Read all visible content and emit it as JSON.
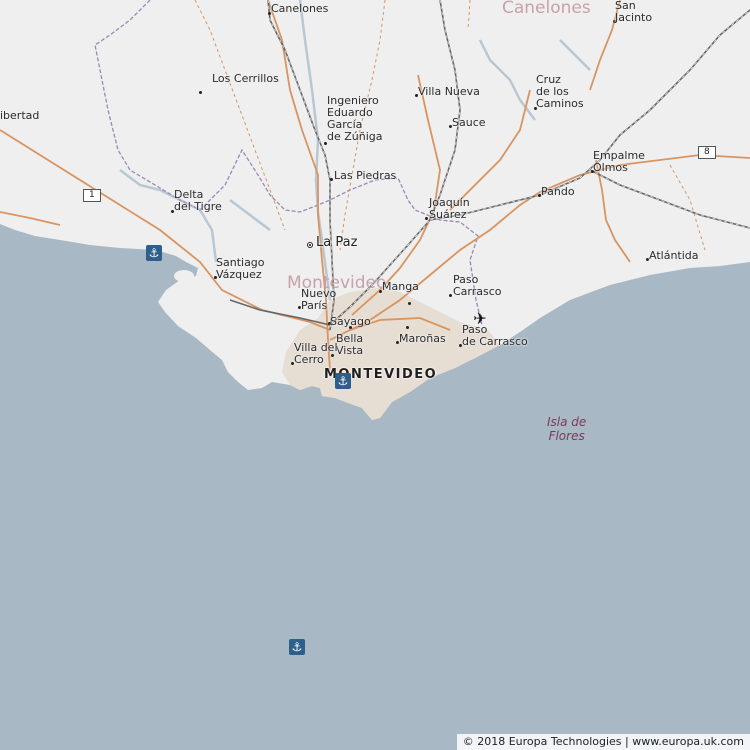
{
  "map": {
    "colors": {
      "water": "#a9b8c5",
      "land": "#efefef",
      "urban": "#e6ddd3",
      "road": "#d99460",
      "rail": "#666666",
      "border": "#9a88b8",
      "river": "#b9c7d3"
    },
    "admin_labels": {
      "canelones_dept": "Canelones",
      "montevideo_dept": "Montevideo"
    },
    "capital": "MONTEVIDEO",
    "major_town": "La Paz",
    "places": {
      "canelones": "Canelones",
      "san_jacinto": "San\nJacinto",
      "los_cerrillos": "Los Cerrillos",
      "libertad": "ibertad",
      "villa_nueva": "Villa Nueva",
      "ingeniero": "Ingeniero\nEduardo\nGarcía\nde Zúñiga",
      "cruz_de_los_caminos": "Cruz\nde los\nCaminos",
      "sauce": "Sauce",
      "empalme_olmos": "Empalme\nOlmos",
      "las_piedras": "Las Piedras",
      "pando": "Pando",
      "delta_del_tigre": "Delta\ndel Tigre",
      "joaquin_suarez": "Joaquín\nSuárez",
      "atlantida": "Atlántida",
      "santiago_vazquez": "Santiago\nVázquez",
      "paso_carrasco": "Paso\nCarrasco",
      "manga": "Manga",
      "nuevo_paris": "Nuevo\nParís",
      "sayago": "Sayago",
      "paso_de_carrasco": "Paso\nde Carrasco",
      "maronas": "Maroñas",
      "bella_vista": "Bella\nVista",
      "villa_del_cerro": "Villa del\nCerro"
    },
    "island": "Isla de\nFlores",
    "road_shields": {
      "route_1": "1",
      "route_8": "8"
    },
    "icons": {
      "port": "anchor-icon",
      "airport": "airplane-icon"
    },
    "copyright": "© 2018 Europa Technologies | www.europa.uk.com"
  }
}
